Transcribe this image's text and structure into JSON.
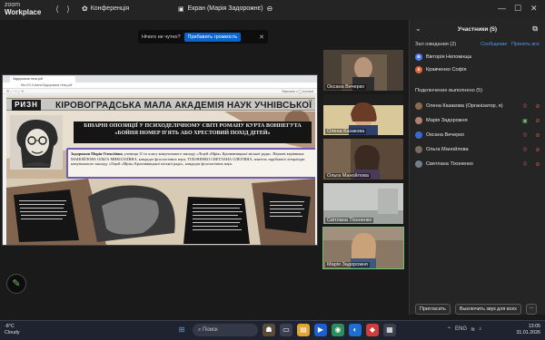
{
  "app": {
    "logo_line1": "zoom",
    "logo_line2": "Workplace"
  },
  "topbar": {
    "conference_label": "Конференція",
    "screen_tab_label": "Екран (Марія Задорожнє)"
  },
  "notification": {
    "question": "Нічого не чутно?",
    "button": "Прибавить громкость"
  },
  "shared_screen": {
    "browser_tab": "Задорожна тези.pdf",
    "address": "file:///C:/Users/Задорожна тези.pdf",
    "pdf_toolbar_right": "Виконати з ◯ Acrobat",
    "slide": {
      "logo_text": "РИЗН",
      "academy_title": "КІРОВОГРАДСЬКА МАЛА АКАДЕМІЯ НАУК УЧНІВСЬКОЇ МОЛОДІ",
      "thesis_title": "БІНАРНІ ОПОЗИЦІЇ У ПСИХОДЕЛІЧНОМУ СВІТІ РОМАНУ КУРТА ВОННЕГУТА «БОЙНЯ НОМЕР П'ЯТЬ АБО ХРЕСТОВИЙ ПОХІД ДІТЕЙ»",
      "author_name": "Задорожня Марія Олексіївна",
      "author_text": ", учениця 11-го класу комунального закладу «Ліцей «Мрія» Кропивницької міської ради». Наукові керівники: МАНОЙЛОВА ОЛЬГА МИКОЛАЇВНА, кандидат філологічних наук; ТІХОНЕНКО СВЕТЛАНА ОЛЕГІВНА, вчитель зарубіжної літератури комунального закладу «Ліцей «Мрія» Кропивницької міської ради», кандидат філологічних наук."
    }
  },
  "video_tiles": [
    {
      "name": "Оксана Вечерко"
    },
    {
      "name": "Олена Казакова"
    },
    {
      "name": "Ольга Манойлова"
    },
    {
      "name": "Світлана Тіхоненко"
    },
    {
      "name": "Марія Задорожня"
    }
  ],
  "participants_panel": {
    "title": "Участники (5)",
    "waiting_header": "Зал ожидания (2)",
    "waiting_links": {
      "message": "Сообщение",
      "admit_all": "Принять все"
    },
    "waiting": [
      {
        "initial": "В",
        "name": "Вікторія Непомнща",
        "color": "#4d7ee8"
      },
      {
        "initial": "К",
        "name": "Кравченко Софія",
        "color": "#e0673a"
      }
    ],
    "connected_header": "Подключение выполнено (5)",
    "connected": [
      {
        "name": "Олена Казакова (Організатор, я)",
        "color": "#8a6b4f",
        "status": "🎤",
        "camera": "⏺"
      },
      {
        "name": "Марія Задорожня",
        "color": "#b08070",
        "status": "▣",
        "camera": "⏺"
      },
      {
        "name": "Оксана Вечерко",
        "color": "#3a6ad0",
        "status": "🎤",
        "camera": "⏺"
      },
      {
        "name": "Ольга Манойлова",
        "color": "#7b6a5a",
        "status": "🎤",
        "camera": "⏺"
      },
      {
        "name": "Светлана Тіхоненко",
        "color": "#6f7f8f",
        "status": "🎤",
        "camera": "⏺"
      }
    ],
    "invite_button": "Пригласить",
    "mute_all_button": "Выключить звук для всех",
    "more_button": "..."
  },
  "taskbar": {
    "temperature": "-8°C",
    "weather": "Cloudy",
    "search_placeholder": "Поиск",
    "language": "ENG",
    "time": "13:05",
    "date": "31.01.2026"
  },
  "colors": {
    "accent_blue": "#0b63ce",
    "link_blue": "#4c9bf0",
    "muted_red": "#d85a5a",
    "active_green": "#6fc36f"
  }
}
